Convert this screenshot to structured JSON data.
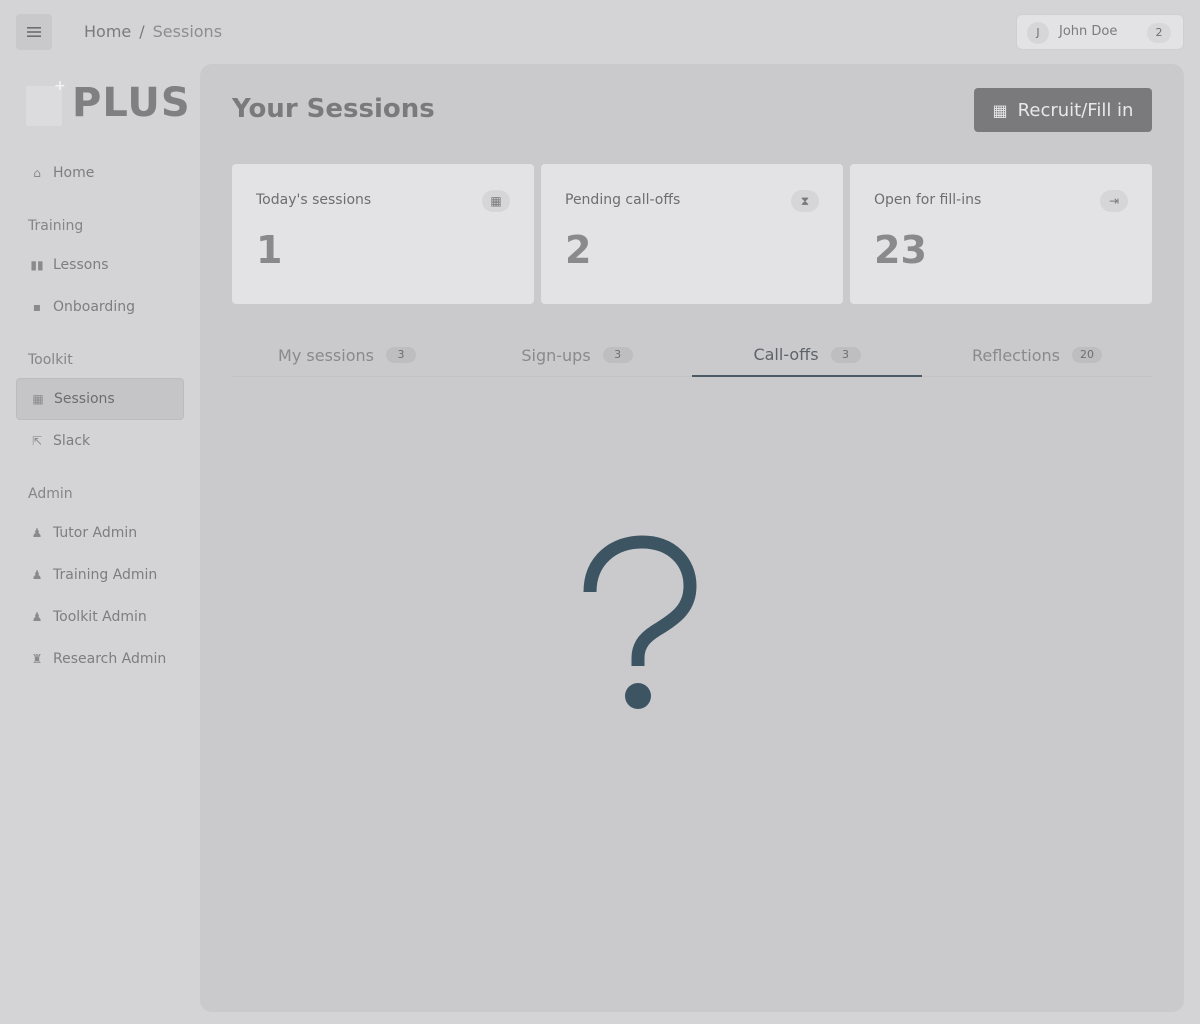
{
  "topbar": {
    "breadcrumb": [
      "Home",
      "Sessions"
    ],
    "separator": "/",
    "user": {
      "initial": "J",
      "name": "John Doe",
      "badge": "2"
    }
  },
  "sidebar": {
    "logo_text": "PLUS",
    "home": "Home",
    "sections": [
      {
        "title": "Training",
        "items": [
          "Lessons",
          "Onboarding"
        ]
      },
      {
        "title": "Toolkit",
        "items": [
          "Sessions",
          "Slack"
        ]
      },
      {
        "title": "Admin",
        "items": [
          "Tutor Admin",
          "Training Admin",
          "Toolkit Admin",
          "Research Admin"
        ]
      }
    ],
    "active_item": "Sessions"
  },
  "main": {
    "title": "Your Sessions",
    "cta_label": "Recruit/Fill in",
    "stats": [
      {
        "label": "Today's sessions",
        "value": "1",
        "icon": "calendar-icon"
      },
      {
        "label": "Pending call-offs",
        "value": "2",
        "icon": "hourglass-icon"
      },
      {
        "label": "Open for fill-ins",
        "value": "23",
        "icon": "sign-in-icon"
      }
    ],
    "tabs": [
      {
        "label": "My sessions",
        "count": "3"
      },
      {
        "label": "Sign-ups",
        "count": "3"
      },
      {
        "label": "Call-offs",
        "count": "3"
      },
      {
        "label": "Reflections",
        "count": "20"
      }
    ],
    "active_tab": "Call-offs"
  },
  "colors": {
    "accent": "#4a5966",
    "empty_icon": "#3d5463"
  }
}
